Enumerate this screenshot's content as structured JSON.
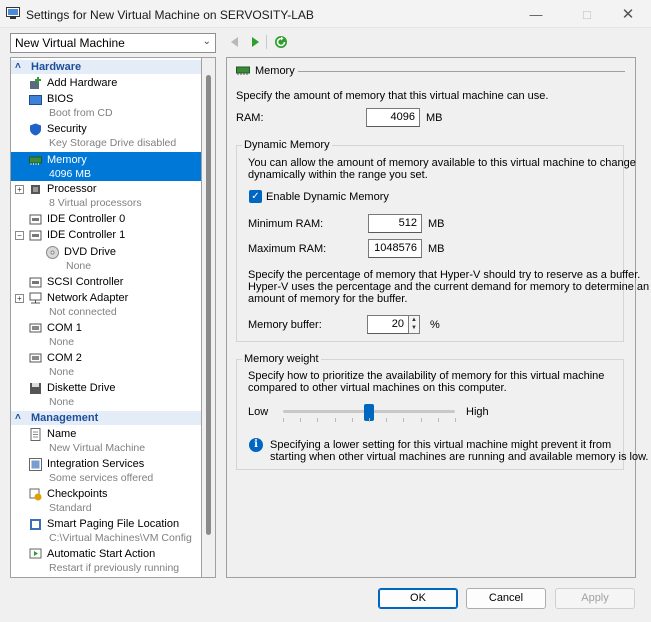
{
  "window": {
    "title": "Settings for New Virtual Machine on SERVOSITY-LAB"
  },
  "toolbar": {
    "vm_selector": "New Virtual Machine"
  },
  "tree": {
    "hardware_label": "Hardware",
    "management_label": "Management",
    "hardware_items": [
      {
        "label": "Add Hardware",
        "sub": ""
      },
      {
        "label": "BIOS",
        "sub": "Boot from CD"
      },
      {
        "label": "Security",
        "sub": "Key Storage Drive disabled"
      },
      {
        "label": "Memory",
        "sub": "4096 MB"
      },
      {
        "label": "Processor",
        "sub": "8 Virtual processors"
      },
      {
        "label": "IDE Controller 0",
        "sub": ""
      },
      {
        "label": "IDE Controller 1",
        "sub": ""
      },
      {
        "label": "DVD Drive",
        "sub": "None"
      },
      {
        "label": "SCSI Controller",
        "sub": ""
      },
      {
        "label": "Network Adapter",
        "sub": "Not connected"
      },
      {
        "label": "COM 1",
        "sub": "None"
      },
      {
        "label": "COM 2",
        "sub": "None"
      },
      {
        "label": "Diskette Drive",
        "sub": "None"
      }
    ],
    "management_items": [
      {
        "label": "Name",
        "sub": "New Virtual Machine"
      },
      {
        "label": "Integration Services",
        "sub": "Some services offered"
      },
      {
        "label": "Checkpoints",
        "sub": "Standard"
      },
      {
        "label": "Smart Paging File Location",
        "sub": "C:\\Virtual Machines\\VM Config"
      },
      {
        "label": "Automatic Start Action",
        "sub": "Restart if previously running"
      }
    ]
  },
  "memory": {
    "header": "Memory",
    "intro": "Specify the amount of memory that this virtual machine can use.",
    "ram_label": "RAM:",
    "ram_value": "4096",
    "unit_mb": "MB",
    "dynamic": {
      "title": "Dynamic Memory",
      "desc_line1": "You can allow the amount of memory available to this virtual machine to change",
      "desc_line2": "dynamically within the range you set.",
      "enable_label": "Enable Dynamic Memory",
      "enabled": true,
      "min_label": "Minimum RAM:",
      "min_value": "512",
      "max_label": "Maximum RAM:",
      "max_value": "1048576",
      "buffer_desc_line1": "Specify the percentage of memory that Hyper-V should try to reserve as a buffer.",
      "buffer_desc_line2": "Hyper-V uses the percentage and the current demand for memory to determine an",
      "buffer_desc_line3": "amount of memory for the buffer.",
      "buffer_label": "Memory buffer:",
      "buffer_value": "20",
      "percent": "%"
    },
    "weight": {
      "title": "Memory weight",
      "desc_line1": "Specify how to prioritize the availability of memory for this virtual machine",
      "desc_line2": "compared to other virtual machines on this computer.",
      "low_label": "Low",
      "high_label": "High",
      "level_fraction": 0.5,
      "info_line1": "Specifying a lower setting for this virtual machine might prevent it from",
      "info_line2": "starting when other virtual machines are running and available memory is low."
    }
  },
  "buttons": {
    "ok": "OK",
    "cancel": "Cancel",
    "apply": "Apply"
  },
  "colors": {
    "accent": "#0078d7",
    "section": "#1c4e9a"
  }
}
